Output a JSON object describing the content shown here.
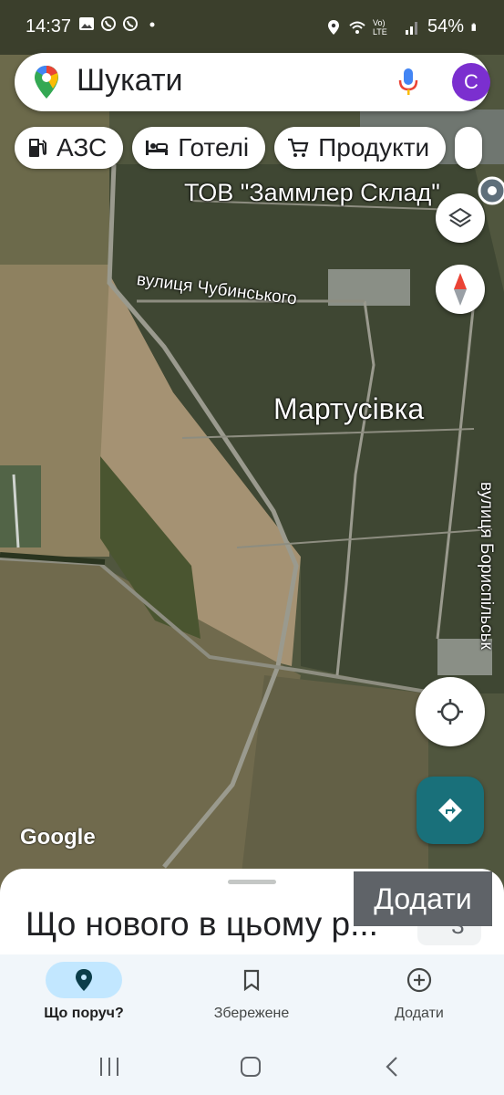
{
  "status_bar": {
    "time": "14:37",
    "battery": "54%",
    "network": "Vo) LTE",
    "left_icons": [
      "gallery-icon",
      "whatsapp-icon",
      "whatsapp-icon",
      "dot-icon"
    ],
    "right_icons": [
      "location-icon",
      "wifi-icon",
      "signal-icon",
      "battery-icon"
    ]
  },
  "search": {
    "placeholder": "Шукати",
    "avatar_letter": "C"
  },
  "chips": [
    {
      "label": "АЗС",
      "icon": "gas-station-icon"
    },
    {
      "label": "Готелі",
      "icon": "hotel-icon"
    },
    {
      "label": "Продукти",
      "icon": "cart-icon"
    }
  ],
  "map": {
    "labels": {
      "company": "ТОВ \"Заммлер Склад\"",
      "street1": "вулиця Чубинського",
      "village": "Мартусівка",
      "street2": "вулиця Бориспільськ"
    },
    "attribution": "Google"
  },
  "sheet": {
    "title": "Що нового в цьому р...",
    "tooltip": "Додати",
    "temperature": "3°"
  },
  "bottom_nav": [
    {
      "label": "Що поруч?",
      "icon": "location-pin-icon",
      "active": true
    },
    {
      "label": "Збережене",
      "icon": "bookmark-icon",
      "active": false
    },
    {
      "label": "Додати",
      "icon": "add-circle-icon",
      "active": false
    }
  ],
  "colors": {
    "accent_teal": "#19707a",
    "avatar_purple": "#7b2fcf",
    "active_pill": "#c2e7ff"
  }
}
